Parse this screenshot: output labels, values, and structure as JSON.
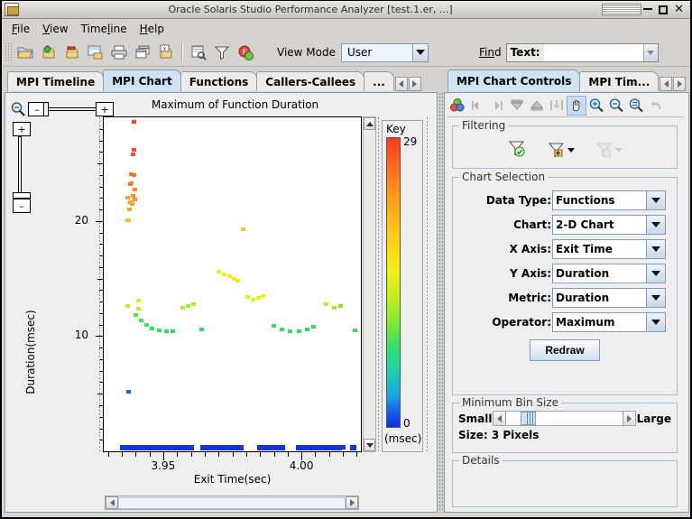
{
  "window": {
    "title": "Oracle Solaris Studio Performance Analyzer [test.1.er, ...]",
    "minimize": "–",
    "maximize": "□",
    "close": "✕"
  },
  "menubar": {
    "items": [
      {
        "label": "File",
        "mnemonic": "F"
      },
      {
        "label": "View",
        "mnemonic": "V"
      },
      {
        "label": "Timeline",
        "mnemonic": "l"
      },
      {
        "label": "Help",
        "mnemonic": "H"
      }
    ]
  },
  "toolbar": {
    "icons": [
      "open-experiment-icon",
      "add-experiment-icon",
      "drop-experiment-icon",
      "save-experiment-icon",
      "print-icon",
      "new-window-icon",
      "close-window-icon",
      "settings-icon",
      "filter-icon",
      "stop-record-icon"
    ],
    "view_mode_label": "View Mode",
    "view_mode_value": "User",
    "find_label": "Find",
    "find_field_label": "Text:",
    "find_value": "",
    "find_placeholder": ""
  },
  "left_tabs": {
    "items": [
      {
        "label": "MPI Timeline",
        "selected": false
      },
      {
        "label": "MPI Chart",
        "selected": true
      },
      {
        "label": "Functions",
        "selected": false
      },
      {
        "label": "Callers-Callees",
        "selected": false
      },
      {
        "label": "...",
        "selected": false
      }
    ]
  },
  "right_tabs": {
    "items": [
      {
        "label": "MPI Chart Controls",
        "selected": true
      },
      {
        "label": "MPI Tim...",
        "selected": false
      }
    ]
  },
  "chart_panel": {
    "zoom_magnifier_icon": "zoom-magnifier-icon",
    "h_zoom_out": "–",
    "h_zoom_in": "+",
    "v_zoom_in": "+",
    "v_zoom_out": "–",
    "key": {
      "title": "Key",
      "max": "29",
      "min": "0",
      "units": "(msec)"
    },
    "scroll_up_icon": "scroll-up-icon",
    "scroll_down_icon": "scroll-down-icon",
    "hscroll_left_icon": "scroll-left-icon",
    "hscroll_right_icon": "scroll-right-icon"
  },
  "chart_data": {
    "type": "scatter",
    "title": "Maximum of Function Duration",
    "xlabel": "Exit Time(sec)",
    "ylabel": "Duration(msec)",
    "xlim": [
      3.9285,
      4.0215
    ],
    "ylim": [
      0.0,
      29.0
    ],
    "xticks": [
      3.95,
      4.0
    ],
    "xtick_labels": [
      "3.95",
      "4.00"
    ],
    "yticks": [
      10,
      20
    ],
    "ytick_labels": [
      "10",
      "20"
    ],
    "grid": false,
    "legend": "colorbar-right",
    "colorbar": {
      "min": 0,
      "max": 29,
      "units": "msec",
      "colors": [
        "#0b2fe0",
        "#1450e8",
        "#1aa8e0",
        "#1fd2a8",
        "#37e06a",
        "#7ee831",
        "#c8ef1f",
        "#f2ee17",
        "#ffd817",
        "#ffb81a",
        "#ff9a1c",
        "#ff6a1e",
        "#ff3b20"
      ]
    },
    "points": [
      {
        "x": 3.9395,
        "y": 28.6,
        "c": "#f63f2a"
      },
      {
        "x": 3.9393,
        "y": 26.2,
        "c": "#f7452c"
      },
      {
        "x": 3.939,
        "y": 25.8,
        "c": "#f74b2e"
      },
      {
        "x": 3.9385,
        "y": 24.1,
        "c": "#f4712b"
      },
      {
        "x": 3.9395,
        "y": 24.0,
        "c": "#f4752b"
      },
      {
        "x": 3.9382,
        "y": 23.2,
        "c": "#f4792c"
      },
      {
        "x": 3.9385,
        "y": 23.3,
        "c": "#f47a2c"
      },
      {
        "x": 3.9396,
        "y": 22.7,
        "c": "#f58a2b"
      },
      {
        "x": 3.939,
        "y": 22.2,
        "c": "#f88f29"
      },
      {
        "x": 3.9396,
        "y": 21.9,
        "c": "#f99228"
      },
      {
        "x": 3.938,
        "y": 21.6,
        "c": "#fb9b26"
      },
      {
        "x": 3.9386,
        "y": 21.5,
        "c": "#fb9e26"
      },
      {
        "x": 3.9378,
        "y": 21.0,
        "c": "#fca724"
      },
      {
        "x": 3.9372,
        "y": 22.0,
        "c": "#fba328"
      },
      {
        "x": 3.937,
        "y": 20.1,
        "c": "#fdc020"
      },
      {
        "x": 3.9375,
        "y": 20.1,
        "c": "#fdc020"
      },
      {
        "x": 3.979,
        "y": 19.3,
        "c": "#fdc41f"
      },
      {
        "x": 3.97,
        "y": 15.6,
        "c": "#f2ee17"
      },
      {
        "x": 3.972,
        "y": 15.4,
        "c": "#f2ee17"
      },
      {
        "x": 3.974,
        "y": 15.2,
        "c": "#f4ec18"
      },
      {
        "x": 3.9755,
        "y": 15.0,
        "c": "#f4ec18"
      },
      {
        "x": 3.977,
        "y": 14.8,
        "c": "#f4ec18"
      },
      {
        "x": 3.941,
        "y": 13.1,
        "c": "#d6f11b"
      },
      {
        "x": 3.9805,
        "y": 13.4,
        "c": "#e3f019"
      },
      {
        "x": 3.9825,
        "y": 13.2,
        "c": "#dff019"
      },
      {
        "x": 3.9845,
        "y": 13.3,
        "c": "#dff019"
      },
      {
        "x": 3.986,
        "y": 13.5,
        "c": "#e3f019"
      },
      {
        "x": 3.937,
        "y": 12.6,
        "c": "#c2f01e"
      },
      {
        "x": 3.941,
        "y": 12.4,
        "c": "#bdf01f"
      },
      {
        "x": 3.957,
        "y": 12.5,
        "c": "#a9ef22"
      },
      {
        "x": 3.959,
        "y": 12.6,
        "c": "#a9ef22"
      },
      {
        "x": 3.961,
        "y": 12.8,
        "c": "#a5ef22"
      },
      {
        "x": 4.009,
        "y": 12.8,
        "c": "#aeef21"
      },
      {
        "x": 4.012,
        "y": 12.5,
        "c": "#9aee24"
      },
      {
        "x": 4.014,
        "y": 12.6,
        "c": "#82ea2e"
      },
      {
        "x": 3.94,
        "y": 11.8,
        "c": "#4fe348"
      },
      {
        "x": 3.942,
        "y": 11.4,
        "c": "#45e150"
      },
      {
        "x": 3.944,
        "y": 11.0,
        "c": "#3cdf58"
      },
      {
        "x": 3.946,
        "y": 10.7,
        "c": "#36de5e"
      },
      {
        "x": 3.9485,
        "y": 10.5,
        "c": "#32dd62"
      },
      {
        "x": 3.951,
        "y": 10.4,
        "c": "#30dd64"
      },
      {
        "x": 3.9535,
        "y": 10.4,
        "c": "#30dd64"
      },
      {
        "x": 3.964,
        "y": 10.6,
        "c": "#33dd61"
      },
      {
        "x": 3.99,
        "y": 10.9,
        "c": "#35dd5f"
      },
      {
        "x": 3.993,
        "y": 10.6,
        "c": "#31dd63"
      },
      {
        "x": 3.996,
        "y": 10.4,
        "c": "#2edc66"
      },
      {
        "x": 3.999,
        "y": 10.4,
        "c": "#2edc66"
      },
      {
        "x": 4.002,
        "y": 10.6,
        "c": "#31dd63"
      },
      {
        "x": 4.0045,
        "y": 10.8,
        "c": "#34dd60"
      },
      {
        "x": 4.0195,
        "y": 10.5,
        "c": "#2fdc65"
      },
      {
        "x": 3.9375,
        "y": 5.2,
        "c": "#1e5be6"
      },
      {
        "x": 3.94,
        "y": 0.35,
        "c": "#1433e3"
      },
      {
        "x": 3.96,
        "y": 0.35,
        "c": "#1433e3"
      },
      {
        "x": 3.975,
        "y": 0.35,
        "c": "#1433e3"
      },
      {
        "x": 3.99,
        "y": 0.35,
        "c": "#1433e3"
      },
      {
        "x": 4.015,
        "y": 0.35,
        "c": "#1433e3"
      }
    ],
    "baseline_segments": [
      {
        "x0": 3.9345,
        "x1": 3.961,
        "y": 0.35,
        "c": "#1433e3"
      },
      {
        "x0": 3.9635,
        "x1": 3.979,
        "y": 0.35,
        "c": "#1433e3"
      },
      {
        "x0": 3.984,
        "x1": 3.994,
        "y": 0.35,
        "c": "#1433e3"
      },
      {
        "x0": 3.998,
        "x1": 4.0145,
        "y": 0.35,
        "c": "#1433e3"
      },
      {
        "x0": 4.0175,
        "x1": 4.02,
        "y": 0.35,
        "c": "#1433e3"
      }
    ]
  },
  "controls": {
    "toolbar_icons": [
      "color-legend-icon",
      "step-back-icon",
      "step-forward-icon",
      "collapse-down-icon",
      "collapse-up-icon",
      "select-tool-icon",
      "pan-hand-icon",
      "zoom-in-icon",
      "zoom-out-icon",
      "zoom-fit-icon",
      "undo-icon"
    ],
    "filtering": {
      "title": "Filtering",
      "icons": [
        "apply-filter-icon",
        "filter-history-icon",
        "clear-filter-icon"
      ]
    },
    "chart_selection": {
      "title": "Chart Selection",
      "fields": [
        {
          "label": "Data Type:",
          "value": "Functions"
        },
        {
          "label": "Chart:",
          "value": "2-D Chart"
        },
        {
          "label": "X Axis:",
          "value": "Exit Time"
        },
        {
          "label": "Y Axis:",
          "value": "Duration"
        },
        {
          "label": "Metric:",
          "value": "Duration"
        },
        {
          "label": "Operator:",
          "value": "Maximum"
        }
      ],
      "redraw_label": "Redraw"
    },
    "bin_size": {
      "title": "Minimum Bin Size",
      "small_label": "Small",
      "large_label": "Large",
      "size_text": "Size: 3 Pixels"
    },
    "details": {
      "title": "Details",
      "content": ""
    }
  }
}
